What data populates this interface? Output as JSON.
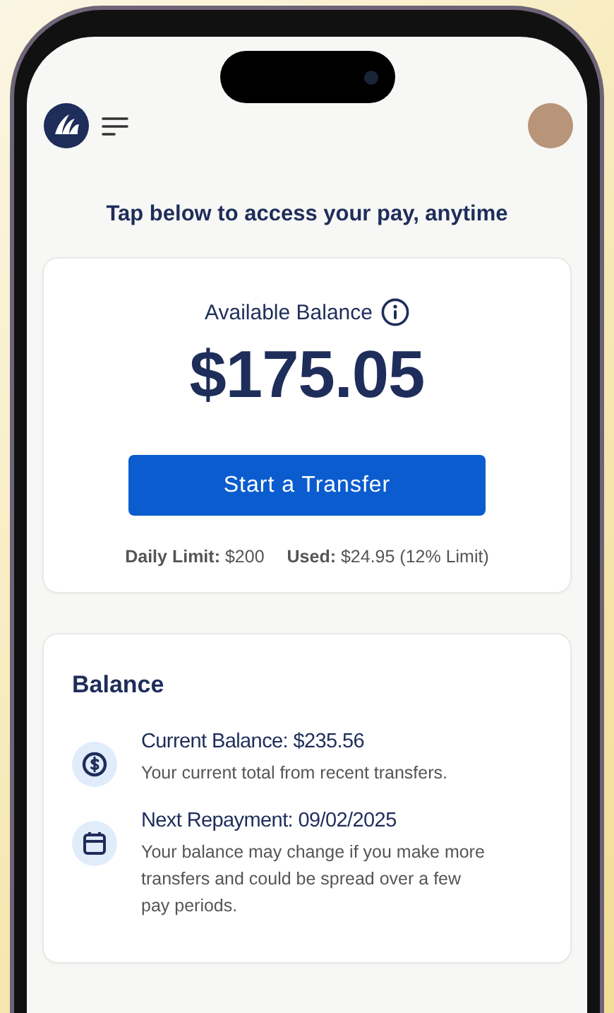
{
  "headline": "Tap below to access your pay, anytime",
  "balance_card": {
    "label": "Available Balance",
    "amount": "$175.05",
    "button": "Start a Transfer",
    "limits": [
      {
        "text": "**Daily Limit:** $200"
      },
      {
        "text": "**Used:** $24.95 (12% Limit)"
      }
    ]
  },
  "balance_section": {
    "title": "Balance",
    "items": [
      {
        "kind": "dollar",
        "label": "Current Balance:",
        "value": "$235.56",
        "description": "Your current total from recent transfers."
      },
      {
        "kind": "calendar",
        "label": "Next Repayment:",
        "value": "09/02/2025",
        "description": "Your balance may change if you make more transfers and could be spread over a few pay periods."
      }
    ]
  }
}
